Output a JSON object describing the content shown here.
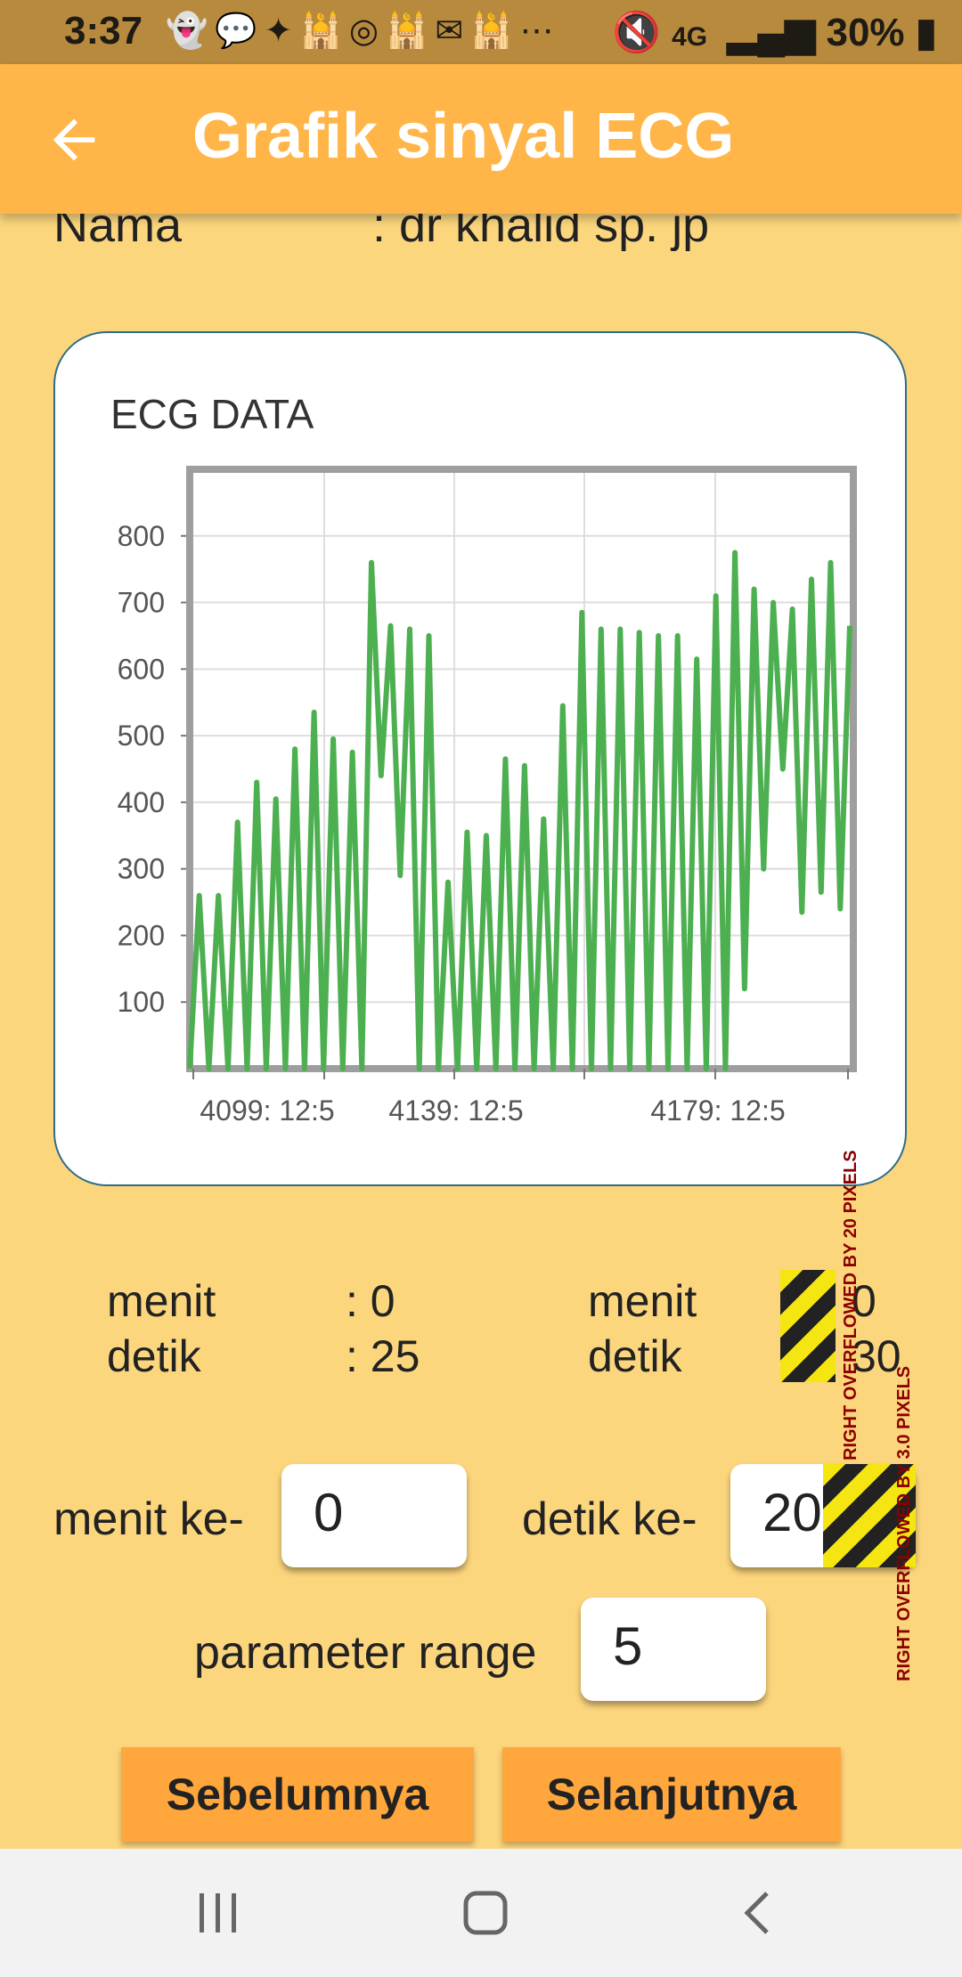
{
  "status_bar": {
    "time": "3:37",
    "notification_icons": [
      "snapchat-icon",
      "chat-icon",
      "app-icon",
      "mosque-icon",
      "instagram-icon",
      "mosque-icon",
      "mail-icon",
      "mosque-icon",
      "more-icon"
    ],
    "network": "4G",
    "battery": "30%"
  },
  "app_bar": {
    "title": "Grafik sinyal ECG"
  },
  "patient": {
    "label": "Nama",
    "value": ": dr khalid sp. jp"
  },
  "chart_data": {
    "type": "line",
    "title": "ECG DATA",
    "xlabel": "",
    "ylabel": "",
    "ylim": [
      0,
      900
    ],
    "yticks": [
      100,
      200,
      300,
      400,
      500,
      600,
      700,
      800
    ],
    "xtick_labels": [
      "4099: 12:5",
      "4139: 12:5",
      "4179: 12:5"
    ],
    "color": "#4CAF50",
    "peaks": [
      260,
      260,
      370,
      430,
      405,
      480,
      535,
      495,
      475,
      760,
      665,
      660,
      650,
      280,
      355,
      350,
      465,
      455,
      375,
      545,
      685,
      660,
      660,
      655,
      650,
      650,
      615,
      710,
      775,
      720,
      700,
      690,
      735,
      760,
      665
    ],
    "troughs": [
      0,
      0,
      0,
      0,
      0,
      0,
      0,
      0,
      0,
      0,
      440,
      290,
      0,
      0,
      0,
      0,
      0,
      0,
      0,
      0,
      0,
      0,
      0,
      0,
      0,
      0,
      0,
      0,
      0,
      120,
      300,
      450,
      235,
      265,
      240
    ]
  },
  "time_info": {
    "left": {
      "menit_label": "menit",
      "menit_value": ": 0",
      "detik_label": "detik",
      "detik_value": ": 25"
    },
    "right": {
      "menit_label": "menit",
      "menit_value": "0",
      "detik_label": "detik",
      "detik_value": "30"
    },
    "overflow_msg_1": "RIGHT OVERFLOWED BY 20 PIXELS",
    "overflow_msg_2": "RIGHT OVERFLOWED BY 3.0 PIXELS"
  },
  "inputs": {
    "menit_label": "menit ke-",
    "menit_value": "0",
    "detik_label": "detik ke-",
    "detik_value": "20",
    "range_label": "parameter range",
    "range_value": "5"
  },
  "buttons": {
    "prev": "Sebelumnya",
    "next": "Selanjutnya"
  },
  "system_nav": {
    "recents_icon": "recents-icon",
    "home_icon": "home-icon",
    "back_icon": "back-icon"
  },
  "colors": {
    "background": "#FCD67D",
    "app_bar": "#FFB548",
    "button": "#FFA63C",
    "line": "#4CAF50",
    "status_bar": "#B88A3E"
  }
}
